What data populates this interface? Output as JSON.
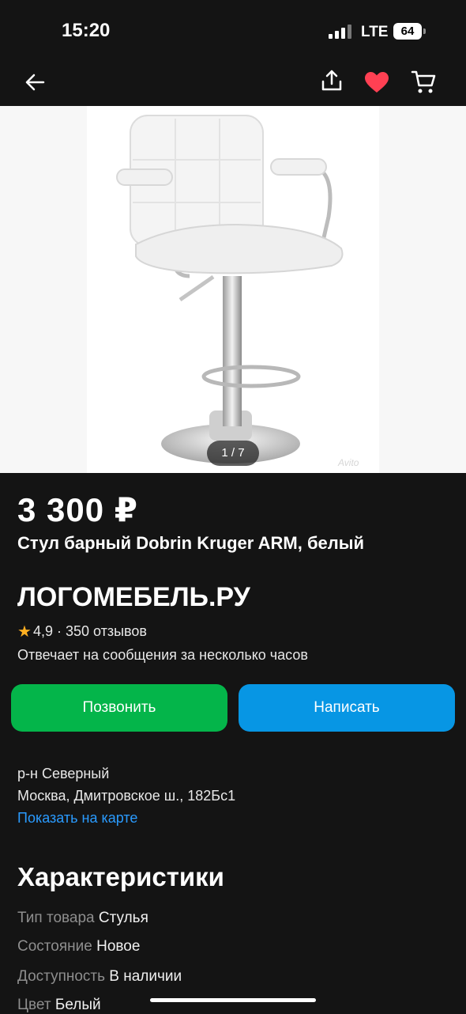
{
  "status_bar": {
    "time": "15:20",
    "network": "LTE",
    "battery": "64"
  },
  "top_bar": {
    "icons": [
      "back-arrow-icon",
      "share-icon",
      "heart-icon",
      "cart-icon"
    ],
    "favorite_color": "#ff4053"
  },
  "gallery": {
    "counter": "1 / 7",
    "watermark": "Avito"
  },
  "listing": {
    "price": "3 300 ₽",
    "title": "Стул барный Dobrin Kruger ARM, белый"
  },
  "seller": {
    "name": "ЛОГОМЕБЕЛЬ.РУ",
    "rating": "4,9",
    "reviews": "· 350 отзывов",
    "response": "Отвечает на сообщения за несколько часов"
  },
  "actions": {
    "call_label": "Позвонить",
    "write_label": "Написать",
    "call_color": "#04b54a",
    "write_color": "#0796e4"
  },
  "location": {
    "district": "р-н Северный",
    "address": "Москва, Дмитровское ш., 182Бс1",
    "map_link": "Показать на карте"
  },
  "characteristics": {
    "title": "Характеристики",
    "items": [
      {
        "key": "Тип товара",
        "value": "Стулья"
      },
      {
        "key": "Состояние",
        "value": "Новое"
      },
      {
        "key": "Доступность",
        "value": "В наличии"
      },
      {
        "key": "Цвет",
        "value": "Белый"
      }
    ]
  }
}
